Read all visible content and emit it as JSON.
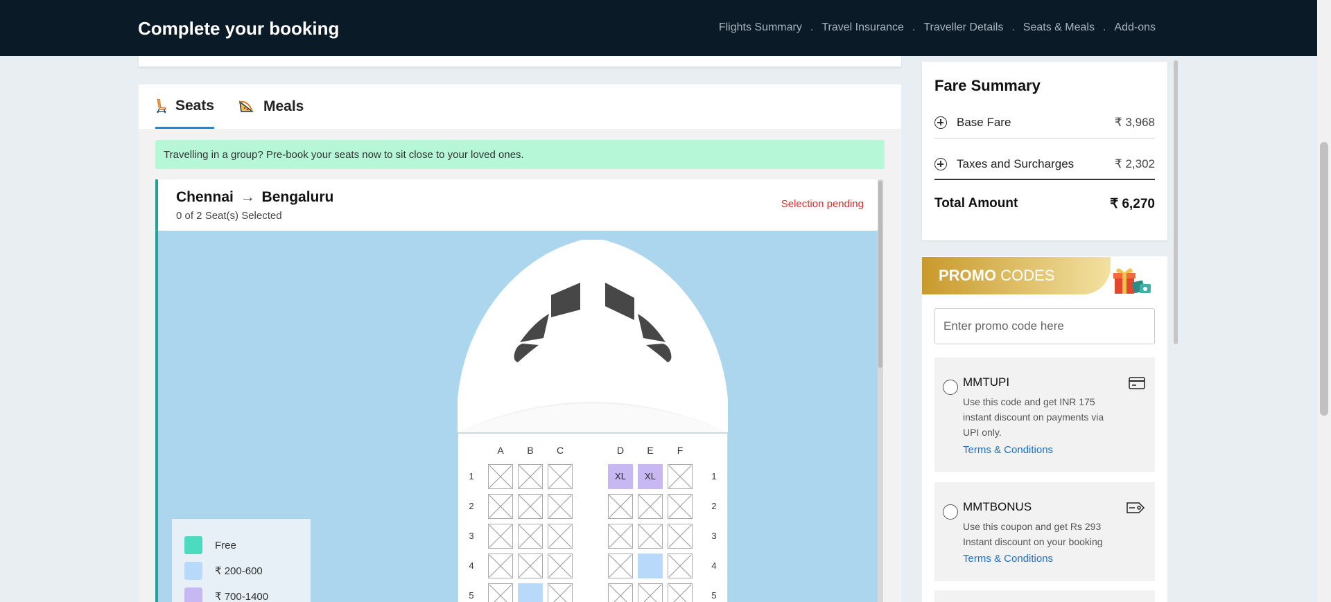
{
  "header": {
    "title": "Complete your booking",
    "steps": [
      "Flights Summary",
      "Travel Insurance",
      "Traveller Details",
      "Seats & Meals",
      "Add-ons"
    ],
    "separator": "."
  },
  "tabs": {
    "seats": "Seats",
    "meals": "Meals"
  },
  "banner": "Travelling in a group? Pre-book your seats now to sit close to your loved ones.",
  "flight": {
    "from": "Chennai",
    "arrow": "→",
    "to": "Bengaluru",
    "seat_count": "0 of 2 Seat(s) Selected",
    "status": "Selection pending"
  },
  "seatmap": {
    "columns": [
      "A",
      "B",
      "C",
      "D",
      "E",
      "F"
    ],
    "rows": [
      {
        "num": "1",
        "seats": [
          "na",
          "na",
          "na",
          "xl",
          "xl",
          "na"
        ]
      },
      {
        "num": "2",
        "seats": [
          "na",
          "na",
          "na",
          "na",
          "na",
          "na"
        ]
      },
      {
        "num": "3",
        "seats": [
          "na",
          "na",
          "na",
          "na",
          "na",
          "na"
        ]
      },
      {
        "num": "4",
        "seats": [
          "na",
          "na",
          "na",
          "na",
          "blue",
          "na"
        ]
      },
      {
        "num": "5",
        "seats": [
          "na",
          "blue",
          "na",
          "na",
          "na",
          "na"
        ]
      }
    ],
    "xl_label": "XL"
  },
  "legend": [
    {
      "label": "Free",
      "color": "#4cdbbf"
    },
    {
      "label": "₹ 200-600",
      "color": "#b9d9fb"
    },
    {
      "label": "₹ 700-1400",
      "color": "#c7b8f3"
    }
  ],
  "fare": {
    "title": "Fare Summary",
    "base_label": "Base Fare",
    "base_amount": "₹ 3,968",
    "tax_label": "Taxes and Surcharges",
    "tax_amount": "₹ 2,302",
    "total_label": "Total Amount",
    "total_amount": "₹ 6,270"
  },
  "promo": {
    "heading_bold": "PROMO",
    "heading_rest": "CODES",
    "placeholder": "Enter promo code here",
    "coupons": [
      {
        "code": "MMTUPI",
        "desc": "Use this code and get INR 175 instant discount on payments via UPI only.",
        "tnc": "Terms & Conditions",
        "icon": "card-icon"
      },
      {
        "code": "MMTBONUS",
        "desc": "Use this coupon and get Rs 293 Instant discount on your booking",
        "tnc": "Terms & Conditions",
        "icon": "tag-icon"
      }
    ]
  },
  "colors": {
    "header_bg": "#0a1a26",
    "accent_blue": "#1e89d6",
    "banner_green": "#b5f7d6",
    "pending_red": "#d0312d",
    "link_blue": "#1a73c9"
  }
}
